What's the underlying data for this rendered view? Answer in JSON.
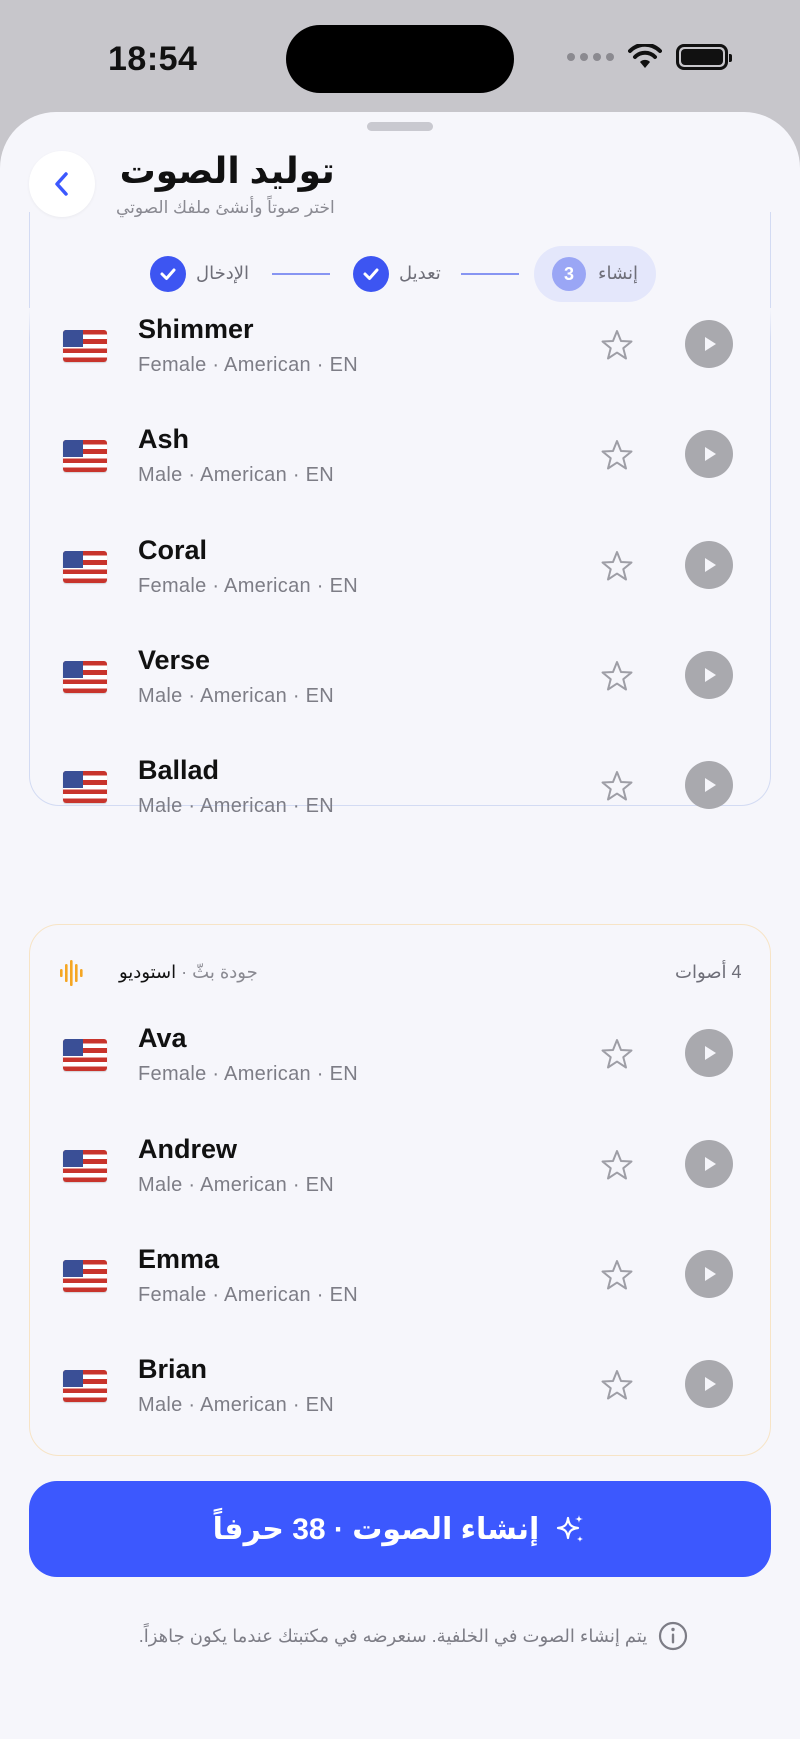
{
  "status_bar": {
    "time": "18:54"
  },
  "header": {
    "title": "توليد الصوت",
    "subtitle": "اختر صوتاً وأنشئ ملفك الصوتي"
  },
  "stepper": {
    "steps": [
      {
        "label": "الإدخال",
        "state": "done"
      },
      {
        "label": "تعديل",
        "state": "done"
      },
      {
        "label": "إنشاء",
        "state": "active",
        "number": "3"
      }
    ]
  },
  "voice_group_1": {
    "voices": [
      {
        "name": "Shimmer",
        "meta": "Female · American · EN"
      },
      {
        "name": "Ash",
        "meta": "Male · American · EN"
      },
      {
        "name": "Coral",
        "meta": "Female · American · EN"
      },
      {
        "name": "Verse",
        "meta": "Male · American · EN"
      },
      {
        "name": "Ballad",
        "meta": "Male · American · EN"
      }
    ]
  },
  "voice_group_2": {
    "tier": "استوديو",
    "quality": "جودة بثّ",
    "count": "4 أصوات",
    "voices": [
      {
        "name": "Ava",
        "meta": "Female · American · EN"
      },
      {
        "name": "Andrew",
        "meta": "Male · American · EN"
      },
      {
        "name": "Emma",
        "meta": "Female · American · EN"
      },
      {
        "name": "Brian",
        "meta": "Male · American · EN"
      }
    ]
  },
  "generate_button": {
    "label": "إنشاء الصوت · 38 حرفاً"
  },
  "footer_note": "يتم إنشاء الصوت في الخلفية. سنعرضه في مكتبتك عندما يكون جاهزاً.",
  "colors": {
    "accent": "#3c58fe",
    "check": "#3d55f2",
    "studio": "#f5a623",
    "play": "#a9a9ae"
  },
  "icons": {
    "back": "chevron-left-icon",
    "favorite": "star-outline-icon",
    "play": "play-icon",
    "studio": "waveform-icon",
    "generate": "sparkles-icon",
    "info": "info-icon"
  }
}
